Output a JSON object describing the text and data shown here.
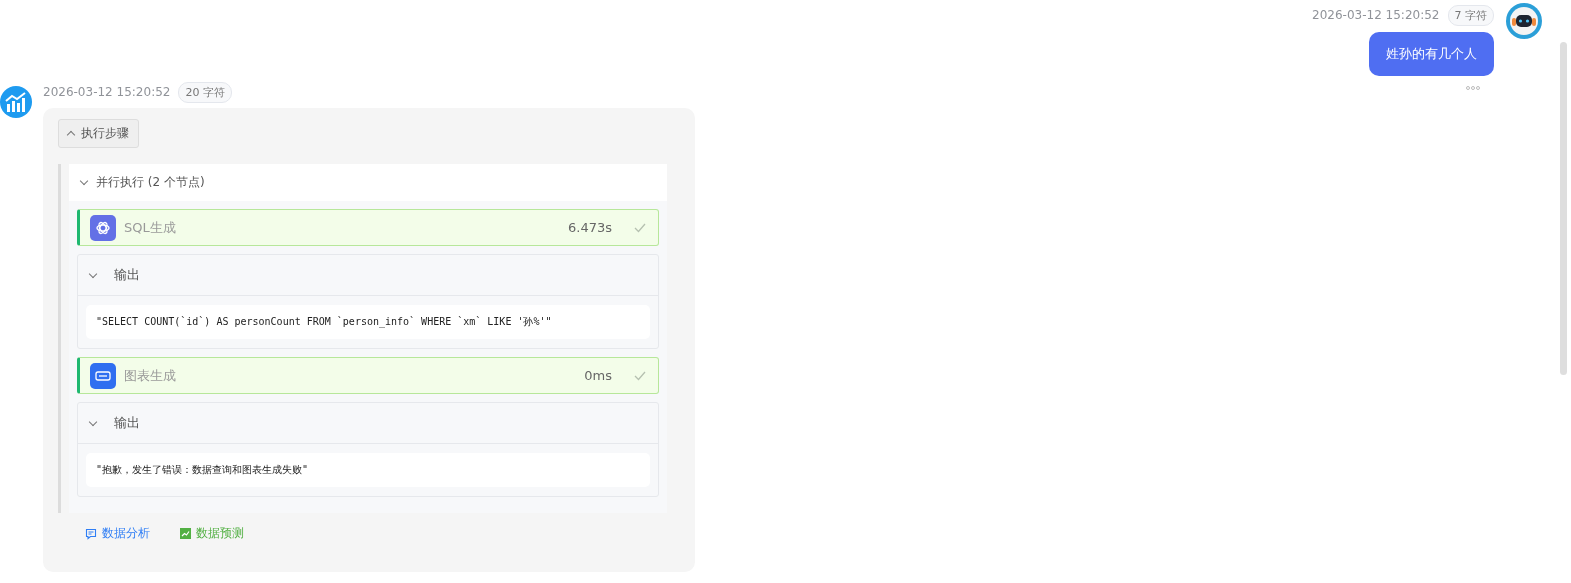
{
  "user_message": {
    "time": "2026-03-12 15:20:52",
    "char_count": "7 字符",
    "text": "姓孙的有几个人"
  },
  "assistant_message": {
    "time": "2026-03-12 15:20:52",
    "char_count": "20 字符",
    "steps_toggle": {
      "label": "执行步骤",
      "expanded": true
    },
    "parallel": {
      "label": "并行执行 (2 个节点)",
      "expanded": true,
      "nodes": [
        {
          "kind": "llm",
          "name": "SQL生成",
          "duration": "6.473s",
          "done": true,
          "output_label": "输出",
          "output_expanded": true,
          "output": "\"SELECT COUNT(`id`) AS personCount FROM `person_info` WHERE `xm` LIKE '孙%'\""
        },
        {
          "kind": "code",
          "name": "图表生成",
          "duration": "0ms",
          "done": true,
          "output_label": "输出",
          "output_expanded": true,
          "output": "\"抱歉，发生了错误：数据查询和图表生成失败\""
        }
      ]
    },
    "actions": [
      {
        "kind": "analysis",
        "label": "数据分析"
      },
      {
        "kind": "predict",
        "label": "数据预测"
      }
    ]
  }
}
